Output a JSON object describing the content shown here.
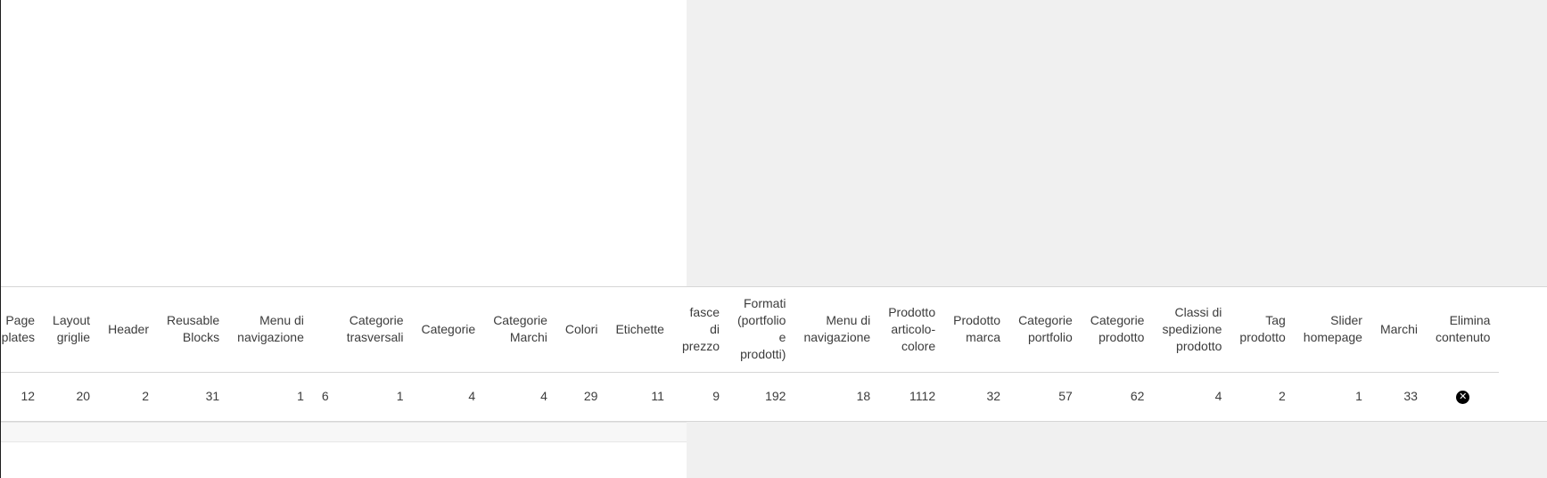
{
  "columns": [
    {
      "key": "page_templates",
      "label": "Page\nmplates"
    },
    {
      "key": "layout_griglie",
      "label": "Layout\ngriglie"
    },
    {
      "key": "header",
      "label": "Header"
    },
    {
      "key": "reusable_blocks",
      "label": "Reusable\nBlocks"
    },
    {
      "key": "menu_di_navigazione_1",
      "label": "Menu di\nnavigazione"
    },
    {
      "key": "unlabeled",
      "label": ""
    },
    {
      "key": "categorie_trasversali",
      "label": "Categorie\ntrasversali"
    },
    {
      "key": "categorie",
      "label": "Categorie"
    },
    {
      "key": "categorie_marchi",
      "label": "Categorie\nMarchi"
    },
    {
      "key": "colori",
      "label": "Colori"
    },
    {
      "key": "etichette",
      "label": "Etichette"
    },
    {
      "key": "fasce_di_prezzo",
      "label": "fasce\ndi\nprezzo"
    },
    {
      "key": "formati",
      "label": "Formati\n(portfolio\ne\nprodotti)"
    },
    {
      "key": "menu_di_navigazione_2",
      "label": "Menu di\nnavigazione"
    },
    {
      "key": "prodotto_articolo_colore",
      "label": "Prodotto\narticolo-\ncolore"
    },
    {
      "key": "prodotto_marca",
      "label": "Prodotto\nmarca"
    },
    {
      "key": "categorie_portfolio",
      "label": "Categorie\nportfolio"
    },
    {
      "key": "categorie_prodotto",
      "label": "Categorie\nprodotto"
    },
    {
      "key": "classi_di_spedizione_prodotto",
      "label": "Classi di\nspedizione\nprodotto"
    },
    {
      "key": "tag_prodotto",
      "label": "Tag\nprodotto"
    },
    {
      "key": "slider_homepage",
      "label": "Slider\nhomepage"
    },
    {
      "key": "marchi",
      "label": "Marchi"
    },
    {
      "key": "elimina_contenuto",
      "label": "Elimina\ncontenuto"
    }
  ],
  "row": [
    "12",
    "20",
    "2",
    "31",
    "1",
    "6",
    "1",
    "4",
    "4",
    "29",
    "11",
    "9",
    "192",
    "18",
    "1112",
    "32",
    "57",
    "62",
    "4",
    "2",
    "1",
    "33",
    ""
  ],
  "delete_icon": {
    "name": "close-circle-icon",
    "glyph": "✕",
    "color": "#000000"
  },
  "colors": {
    "panel_gray": "#f0f0f0",
    "border": "#d6d6d6",
    "text": "#3c3c3c"
  }
}
